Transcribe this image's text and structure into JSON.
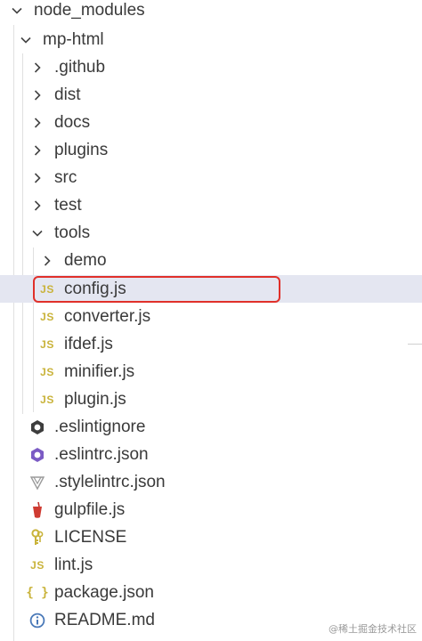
{
  "tree": {
    "node_modules": "node_modules",
    "mp_html": "mp-html",
    "github": ".github",
    "dist": "dist",
    "docs": "docs",
    "plugins": "plugins",
    "src": "src",
    "test": "test",
    "tools": "tools",
    "demo": "demo",
    "config": "config.js",
    "converter": "converter.js",
    "ifdef": "ifdef.js",
    "minifier": "minifier.js",
    "plugin": "plugin.js",
    "eslintignore": ".eslintignore",
    "eslintrc": ".eslintrc.json",
    "stylelintrc": ".stylelintrc.json",
    "gulpfile": "gulpfile.js",
    "license": "LICENSE",
    "lint": "lint.js",
    "package": "package.json",
    "readme": "README.md"
  },
  "badges": {
    "js": "JS",
    "json": "{ }"
  },
  "selected_item": "config.js",
  "colors": {
    "selection_bg": "#e4e6f1",
    "highlight_border": "#e0302a",
    "js_badge": "#c9b33a"
  },
  "watermark": "@稀土掘金技术社区"
}
